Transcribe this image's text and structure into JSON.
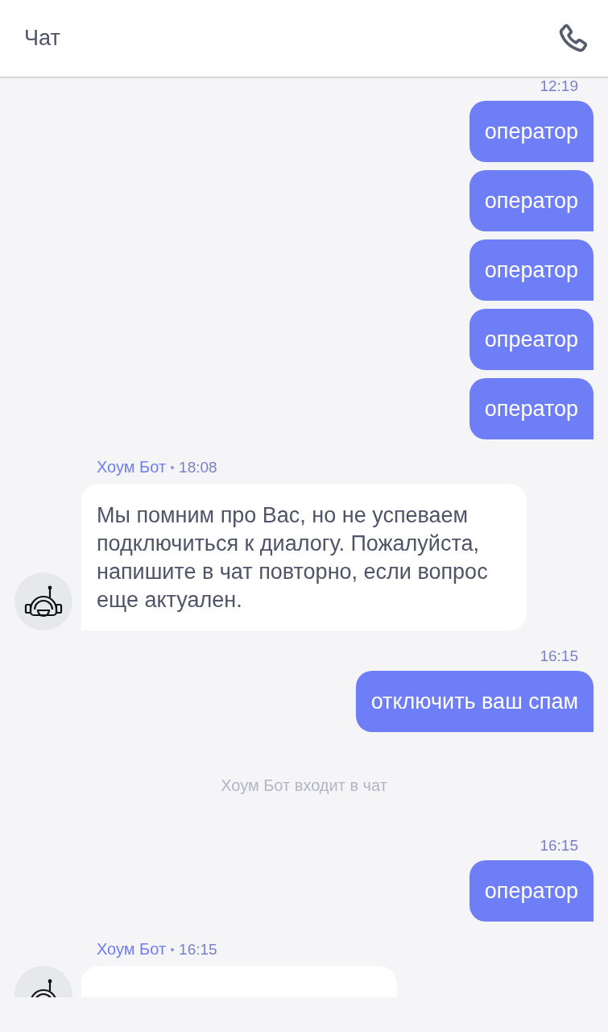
{
  "header": {
    "title": "Чат"
  },
  "messages": [
    {
      "kind": "time",
      "text": "12:19"
    },
    {
      "kind": "outgoing",
      "text": "оператор"
    },
    {
      "kind": "outgoing",
      "text": "оператор"
    },
    {
      "kind": "outgoing",
      "text": "оператор"
    },
    {
      "kind": "outgoing",
      "text": "опреатор"
    },
    {
      "kind": "outgoing",
      "text": "оператор"
    },
    {
      "kind": "incoming",
      "sender": "Хоум Бот",
      "time": "18:08",
      "text": "Мы помним про Вас, но не успеваем подключиться к диалогу. Пожалуйста, напишите в чат повторно, если вопрос еще актуален."
    },
    {
      "kind": "time",
      "text": "16:15"
    },
    {
      "kind": "outgoing",
      "text": "отключить ваш спам"
    },
    {
      "kind": "system",
      "text": "Хоум Бот входит в чат"
    },
    {
      "kind": "time",
      "text": "16:15"
    },
    {
      "kind": "outgoing",
      "text": "оператор"
    },
    {
      "kind": "incoming",
      "sender": "Хоум Бот",
      "time": "16:15"
    }
  ]
}
